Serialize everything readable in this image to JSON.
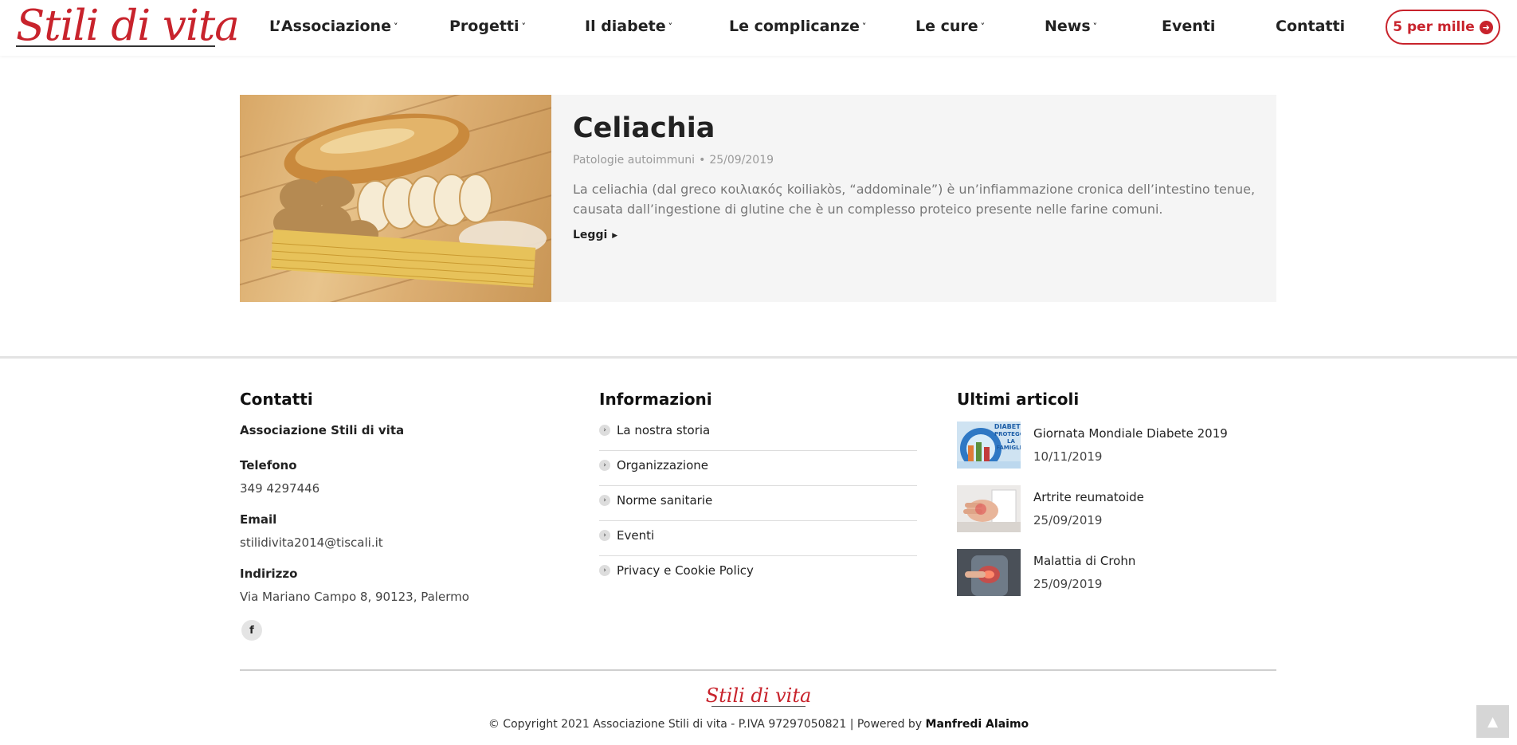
{
  "header": {
    "logo": "Stili di vita",
    "nav": [
      {
        "label": "L’Associazione",
        "caret": true
      },
      {
        "label": "Progetti",
        "caret": true
      },
      {
        "label": "Il diabete",
        "caret": true
      },
      {
        "label": "Le complicanze",
        "caret": true
      },
      {
        "label": "Le cure",
        "caret": true
      },
      {
        "label": "News",
        "caret": true
      },
      {
        "label": "Eventi",
        "caret": false
      },
      {
        "label": "Contatti",
        "caret": false
      }
    ],
    "cta_label": "5 per mille",
    "cta_icon": "circle-arrow-right-icon"
  },
  "article": {
    "title": "Celiachia",
    "category": "Patologie autoimmuni",
    "date": "25/09/2019",
    "excerpt": "La celiachia (dal greco κοιλιακός koiliakòs, “addominale”) è un’infiammazione cronica dell’intestino tenue, causata dall’ingestione di glutine che è un complesso proteico presente nelle farine comuni.",
    "read_more": "Leggi"
  },
  "footer": {
    "contacts": {
      "title": "Contatti",
      "org": "Associazione Stili di vita",
      "phone_label": "Telefono",
      "phone": "349 4297446",
      "email_label": "Email",
      "email": "stilidivita2014@tiscali.it",
      "address_label": "Indirizzo",
      "address": "Via Mariano Campo 8, 90123, Palermo",
      "social": "f"
    },
    "info": {
      "title": "Informazioni",
      "items": [
        "La nostra storia",
        "Organizzazione",
        "Norme sanitarie",
        "Eventi",
        "Privacy e Cookie Policy"
      ]
    },
    "latest": {
      "title": "Ultimi articoli",
      "posts": [
        {
          "title": "Giornata Mondiale Diabete 2019",
          "date": "10/11/2019",
          "thumb_text": "DIABETE PROTEGGI LA FAMIGLIA"
        },
        {
          "title": "Artrite reumatoide",
          "date": "25/09/2019"
        },
        {
          "title": "Malattia di Crohn",
          "date": "25/09/2019"
        }
      ]
    },
    "logo": "Stili di vita",
    "copyright": "© Copyright 2021 Associazione Stili di vita - P.IVA 97297050821 | Powered by ",
    "powered_by": "Manfredi Alaimo"
  },
  "colors": {
    "brand": "#c8232c",
    "card_bg": "#f5f5f5"
  }
}
